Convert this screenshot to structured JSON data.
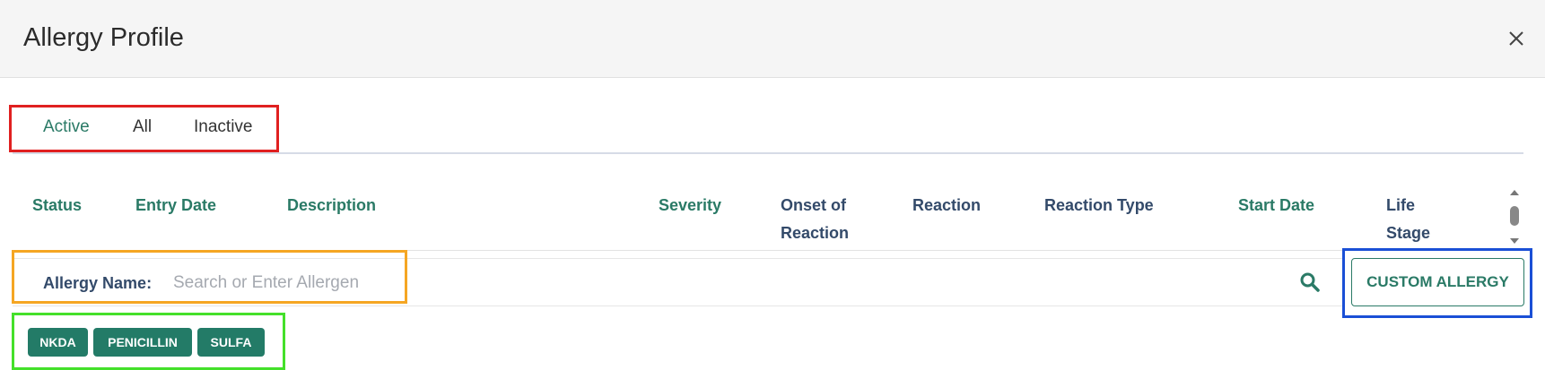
{
  "modal": {
    "title": "Allergy Profile"
  },
  "tabs": [
    {
      "label": "Active",
      "active": true
    },
    {
      "label": "All",
      "active": false
    },
    {
      "label": "Inactive",
      "active": false
    }
  ],
  "table": {
    "columns": [
      "Status",
      "Entry Date",
      "Description",
      "Severity",
      "Onset of\nReaction",
      "Reaction",
      "Reaction Type",
      "Start Date",
      "Life\nStage"
    ]
  },
  "search": {
    "label": "Allergy Name",
    "colon": ":",
    "placeholder": "Search or Enter Allergen",
    "value": ""
  },
  "custom_allergy_button": "CUSTOM ALLERGY",
  "quick_chips": [
    "NKDA",
    "PENICILLIN",
    "SULFA"
  ],
  "icons": {
    "close": "close-icon",
    "search": "search-icon",
    "scroll_up": "chevron-up-icon",
    "scroll_down": "chevron-down-icon"
  },
  "colors": {
    "accent_green": "#2a7a66",
    "chip_green": "#237b67",
    "navy_text": "#334a6a",
    "highlight_red": "#e02020",
    "highlight_orange": "#f5a623",
    "highlight_green": "#44e02a",
    "highlight_blue": "#1a4fd6"
  }
}
